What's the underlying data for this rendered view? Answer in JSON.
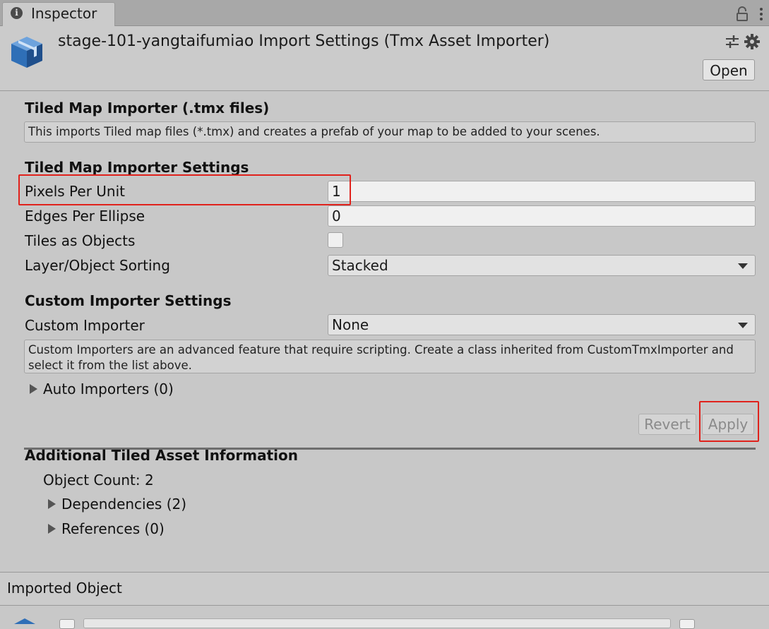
{
  "window": {
    "tab_label": "Inspector",
    "tab_icon": "info-icon",
    "toolbar_icons": [
      "lock-icon",
      "kebab-menu-icon"
    ]
  },
  "header": {
    "title": "stage-101-yangtaifumiao Import Settings (Tmx Asset Importer)",
    "asset_icon": "prefab-cube-icon",
    "icons": [
      "preset-sliders-icon",
      "gear-icon"
    ],
    "open_label": "Open"
  },
  "tiled_importer": {
    "title": "Tiled Map Importer (.tmx files)",
    "help": "This imports Tiled map files (*.tmx) and creates a prefab of your map to be added to your scenes."
  },
  "settings": {
    "title": "Tiled Map Importer Settings",
    "pixels_per_unit": {
      "label": "Pixels Per Unit",
      "value": "1"
    },
    "edges_per_ellipse": {
      "label": "Edges Per Ellipse",
      "value": "0"
    },
    "tiles_as_objects": {
      "label": "Tiles as Objects",
      "checked": false
    },
    "sorting": {
      "label": "Layer/Object Sorting",
      "value": "Stacked"
    }
  },
  "custom": {
    "title": "Custom Importer Settings",
    "importer": {
      "label": "Custom Importer",
      "value": "None"
    },
    "help": "Custom Importers are an advanced feature that require scripting. Create a class inherited from CustomTmxImporter and select it from the list above.",
    "auto_importers": "Auto Importers (0)"
  },
  "actions": {
    "revert_label": "Revert",
    "apply_label": "Apply"
  },
  "additional": {
    "title": "Additional Tiled Asset Information",
    "object_count": "Object Count: 2",
    "dependencies": "Dependencies (2)",
    "references": "References (0)"
  },
  "imported": {
    "label": "Imported Object"
  },
  "colors": {
    "highlight": "#e0221c",
    "panel": "#c8c8c8",
    "prefab_blue": "#2f6fb7"
  }
}
